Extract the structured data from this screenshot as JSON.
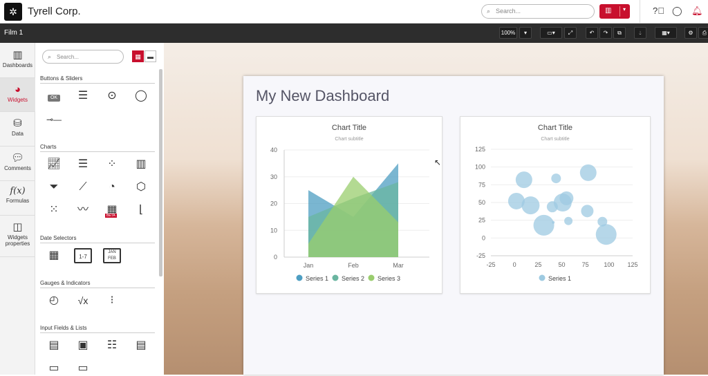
{
  "app": {
    "brand": "Tyrell Corp.",
    "top_search_placeholder": "Search..."
  },
  "toolbar": {
    "film": "Film 1",
    "zoom": "100%"
  },
  "nav": [
    {
      "label": "Dashboards",
      "icon": "bar-chart-icon"
    },
    {
      "label": "Widgets",
      "icon": "palette-icon"
    },
    {
      "label": "Data",
      "icon": "database-icon"
    },
    {
      "label": "Comments",
      "icon": "comments-icon"
    },
    {
      "label": "Formulas",
      "icon": "function-icon",
      "glyph": "f(x)"
    },
    {
      "label": "Widgets properties",
      "icon": "panel-icon"
    }
  ],
  "panel": {
    "search_placeholder": "Search...",
    "sections": [
      "Buttons & Sliders",
      "Charts",
      "Date Selectors",
      "Gauges & Indicators",
      "Input Fields & Lists"
    ],
    "ok_label": "OK",
    "beta_label": "BETA",
    "date_icons": [
      "1-7",
      "JAN FEB"
    ]
  },
  "dashboard": {
    "title": "My New Dashboard"
  },
  "chart_data": [
    {
      "type": "area",
      "title": "Chart Title",
      "subtitle": "Chart subtitle",
      "categories": [
        "Jan",
        "Feb",
        "Mar"
      ],
      "ylim": [
        0,
        40
      ],
      "yticks": [
        0,
        10,
        20,
        30,
        40
      ],
      "grid": true,
      "legend": "bottom",
      "series": [
        {
          "name": "Series 1",
          "values": [
            25,
            15,
            35
          ],
          "color": "#4e9ec2"
        },
        {
          "name": "Series 2",
          "values": [
            15,
            22,
            28
          ],
          "color": "#6ab5a0"
        },
        {
          "name": "Series 3",
          "values": [
            5,
            30,
            13
          ],
          "color": "#9acd6e"
        }
      ]
    },
    {
      "type": "scatter",
      "title": "Chart Title",
      "subtitle": "Chart subtitle",
      "xlim": [
        -25,
        125
      ],
      "xticks": [
        -25,
        0,
        25,
        50,
        75,
        100,
        125
      ],
      "ylim": [
        -25,
        125
      ],
      "yticks": [
        -25,
        0,
        25,
        50,
        75,
        100,
        125
      ],
      "grid": true,
      "legend": "bottom",
      "series": [
        {
          "name": "Series 1",
          "color": "#9ecae1",
          "points": [
            {
              "x": 10,
              "y": 82,
              "size": 12
            },
            {
              "x": 2,
              "y": 52,
              "size": 12
            },
            {
              "x": 17,
              "y": 46,
              "size": 13
            },
            {
              "x": 44,
              "y": 84,
              "size": 7
            },
            {
              "x": 78,
              "y": 92,
              "size": 12
            },
            {
              "x": 31,
              "y": 18,
              "size": 15
            },
            {
              "x": 40,
              "y": 44,
              "size": 8
            },
            {
              "x": 51,
              "y": 50,
              "size": 13
            },
            {
              "x": 55,
              "y": 56,
              "size": 10
            },
            {
              "x": 57,
              "y": 24,
              "size": 6
            },
            {
              "x": 41,
              "y": 22,
              "size": 2
            },
            {
              "x": 77,
              "y": 38,
              "size": 9
            },
            {
              "x": 93,
              "y": 23,
              "size": 7
            },
            {
              "x": 97,
              "y": 5,
              "size": 15
            }
          ]
        }
      ]
    }
  ]
}
